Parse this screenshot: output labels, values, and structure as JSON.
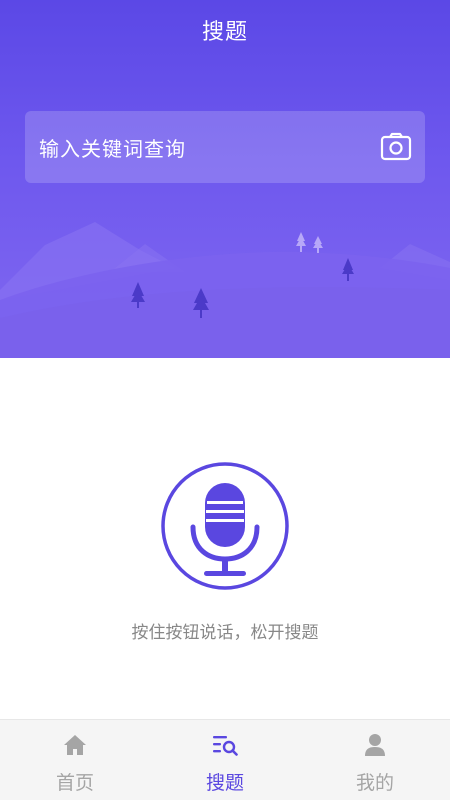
{
  "header": {
    "title": "搜题"
  },
  "search": {
    "placeholder": "输入关键词查询"
  },
  "voice": {
    "hint": "按住按钮说话，松开搜题"
  },
  "tabs": [
    {
      "label": "首页",
      "icon": "home-icon",
      "active": false
    },
    {
      "label": "搜题",
      "icon": "search-list-icon",
      "active": true
    },
    {
      "label": "我的",
      "icon": "user-icon",
      "active": false
    }
  ],
  "colors": {
    "brand": "#5a47e0",
    "tab_inactive": "#a5a5a5",
    "hint": "#888888"
  }
}
